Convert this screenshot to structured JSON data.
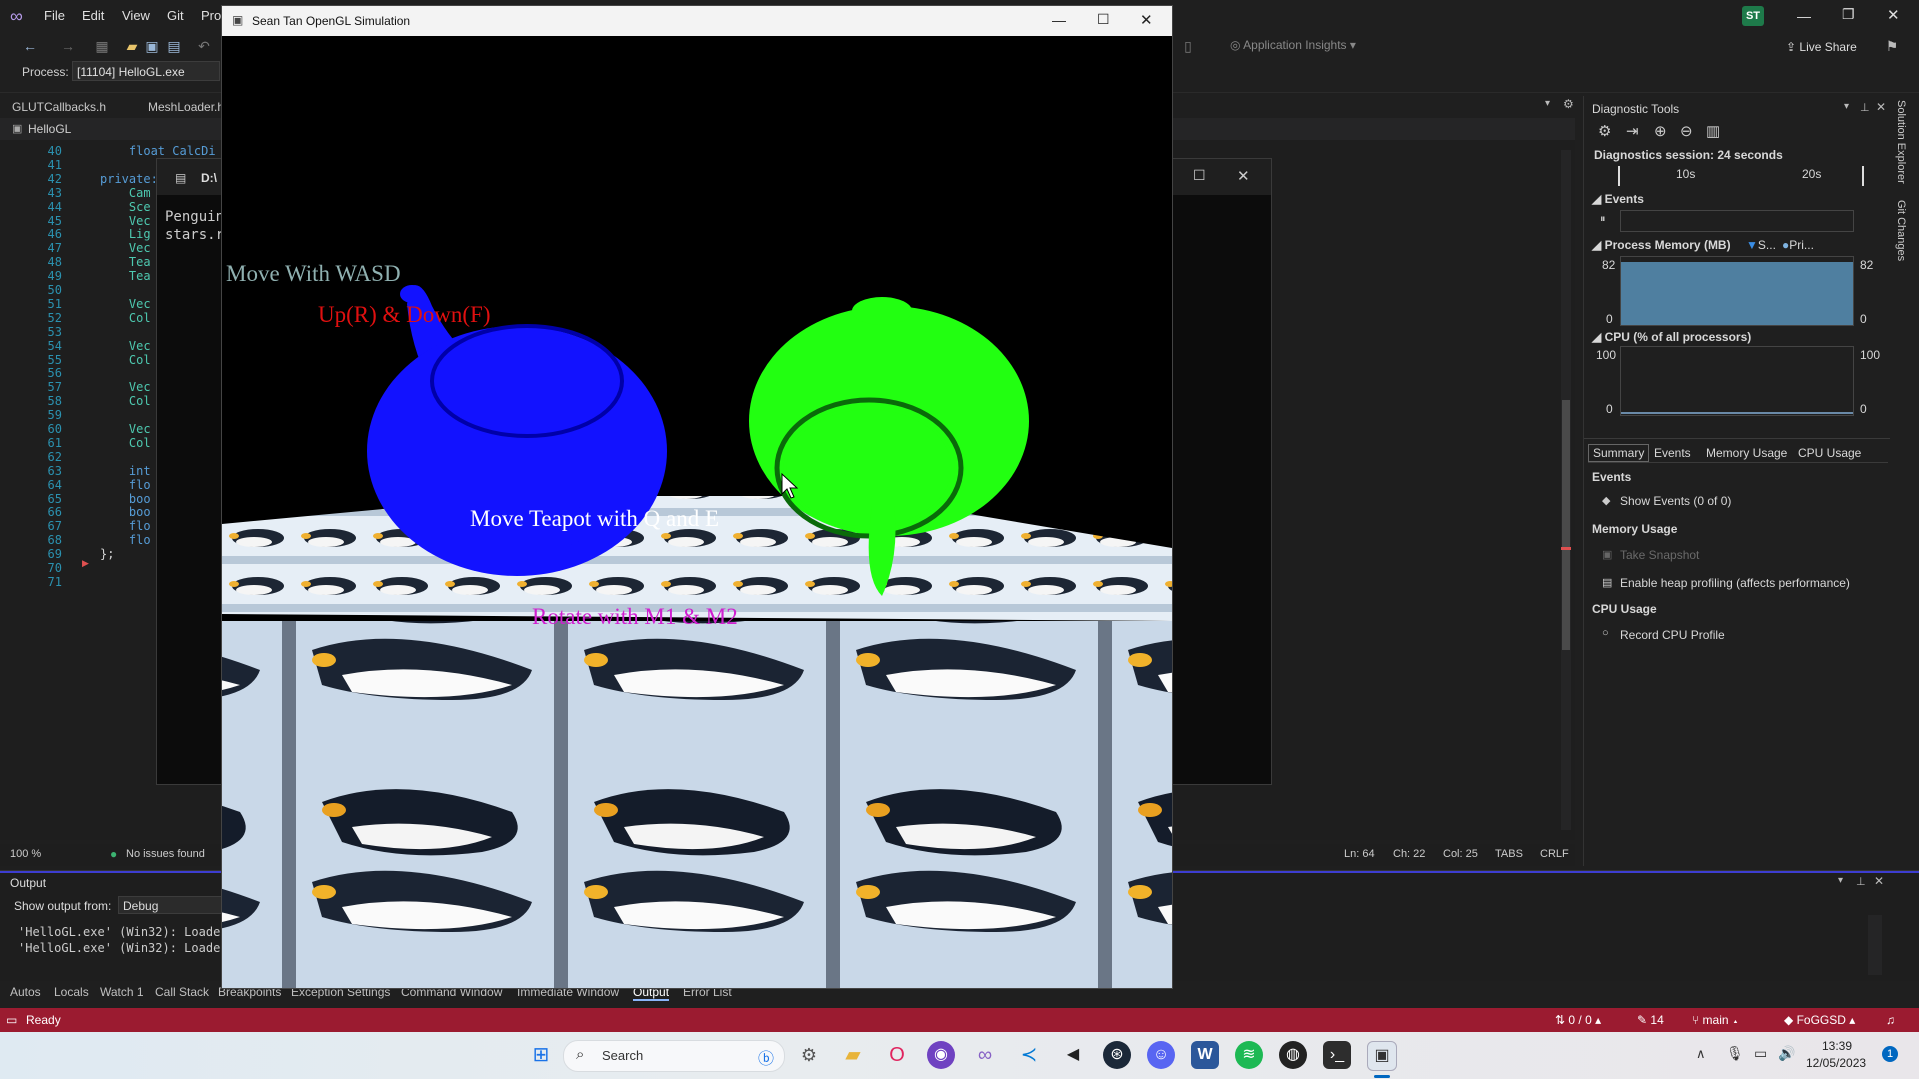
{
  "vs": {
    "menu": [
      "File",
      "Edit",
      "View",
      "Git",
      "Pro"
    ],
    "user_initials": "ST",
    "app_insights": "Application Insights",
    "live_share": "Live Share",
    "process_label": "Process:",
    "process_value": "[11104] HelloGL.exe",
    "doc_tabs": [
      "GLUTCallbacks.h",
      "MeshLoader.h"
    ],
    "nav_item": "HelloGL"
  },
  "editor": {
    "lines": [
      {
        "n": "40",
        "text": "    float CalcDi"
      },
      {
        "n": "41",
        "text": ""
      },
      {
        "n": "42",
        "text": "private:"
      },
      {
        "n": "43",
        "text": "    Cam"
      },
      {
        "n": "44",
        "text": "    Sce"
      },
      {
        "n": "45",
        "text": "    Vec"
      },
      {
        "n": "46",
        "text": "    Lig"
      },
      {
        "n": "47",
        "text": "    Vec"
      },
      {
        "n": "48",
        "text": "    Tea"
      },
      {
        "n": "49",
        "text": "    Tea"
      },
      {
        "n": "50",
        "text": ""
      },
      {
        "n": "51",
        "text": "    Vec"
      },
      {
        "n": "52",
        "text": "    Col"
      },
      {
        "n": "53",
        "text": ""
      },
      {
        "n": "54",
        "text": "    Vec"
      },
      {
        "n": "55",
        "text": "    Col"
      },
      {
        "n": "56",
        "text": ""
      },
      {
        "n": "57",
        "text": "    Vec"
      },
      {
        "n": "58",
        "text": "    Col"
      },
      {
        "n": "59",
        "text": ""
      },
      {
        "n": "60",
        "text": "    Vec"
      },
      {
        "n": "61",
        "text": "    Col"
      },
      {
        "n": "62",
        "text": ""
      },
      {
        "n": "63",
        "text": "    int"
      },
      {
        "n": "64",
        "text": "    flo"
      },
      {
        "n": "65",
        "text": "    boo"
      },
      {
        "n": "66",
        "text": "    boo"
      },
      {
        "n": "67",
        "text": "    flo"
      },
      {
        "n": "68",
        "text": "    flo"
      },
      {
        "n": "69",
        "text": "};"
      },
      {
        "n": "70",
        "text": ""
      },
      {
        "n": "71",
        "text": ""
      }
    ],
    "zoom": "100 %",
    "issues": "No issues found",
    "ln": "Ln: 64",
    "ch": "Ch: 22",
    "col": "Col: 25",
    "tabs": "TABS",
    "crlf": "CRLF"
  },
  "console": {
    "title": "D:\\",
    "line1": "Penguin",
    "line2": "stars.r"
  },
  "gl": {
    "title": "Sean Tan OpenGL Simulation",
    "text_wasd": "Move With WASD",
    "text_updown": "Up(R) & Down(F)",
    "text_teapot": "Move Teapot with Q and E",
    "text_rotate": "Rotate with M1 & M2",
    "colors": {
      "wasd": "#8fb0b0",
      "updown": "#e01010",
      "teapot_text": "#ffffff",
      "rotate": "#d020d0",
      "blue_teapot": "#1010ff",
      "green_teapot": "#22ff11"
    }
  },
  "diag": {
    "title": "Diagnostic Tools",
    "session": "Diagnostics session: 24 seconds",
    "tick_10": "10s",
    "tick_20": "20s",
    "events": "Events",
    "process_memory": "Process Memory (MB)",
    "legend_s": "S...",
    "legend_pri": "Pri...",
    "mem_max_left": "82",
    "mem_min_left": "0",
    "mem_max_right": "82",
    "mem_min_right": "0",
    "cpu": "CPU (% of all processors)",
    "cpu_max_left": "100",
    "cpu_min_left": "0",
    "cpu_max_right": "100",
    "cpu_min_right": "0",
    "tabs": [
      "Summary",
      "Events",
      "Memory Usage",
      "CPU Usage"
    ],
    "sec_events": "Events",
    "show_events": "Show Events (0 of 0)",
    "sec_memory": "Memory Usage",
    "take_snapshot": "Take Snapshot",
    "heap_profiling": "Enable heap profiling (affects performance)",
    "sec_cpu": "CPU Usage",
    "record_cpu": "Record CPU Profile"
  },
  "right_rail": [
    "Solution Explorer",
    "Git Changes"
  ],
  "output": {
    "title": "Output",
    "show_from": "Show output from:",
    "source": "Debug",
    "line1": "'HelloGL.exe' (Win32): Loaded",
    "line2": "'HelloGL.exe' (Win32): Loaded"
  },
  "bottom_tabs": [
    "Autos",
    "Locals",
    "Watch 1",
    "Call Stack",
    "Breakpoints",
    "Exception Settings",
    "Command Window",
    "Immediate Window",
    "Output",
    "Error List"
  ],
  "status": {
    "ready": "Ready",
    "changes": "0 / 0",
    "pencil": "14",
    "branch": "main",
    "repo": "FoGGSD"
  },
  "taskbar": {
    "search": "Search",
    "time": "13:39",
    "date": "12/05/2023",
    "notif": "1"
  }
}
